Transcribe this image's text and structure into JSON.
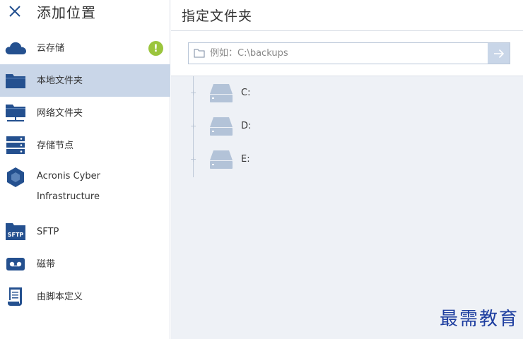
{
  "sidebar": {
    "title": "添加位置",
    "items": [
      {
        "label": "云存储",
        "icon": "cloud-icon",
        "badge": "!"
      },
      {
        "label": "本地文件夹",
        "icon": "folder-icon"
      },
      {
        "label": "网络文件夹",
        "icon": "network-folder-icon"
      },
      {
        "label": "存储节点",
        "icon": "server-icon"
      },
      {
        "label_line1": "Acronis Cyber",
        "label_line2": "Infrastructure",
        "icon": "hexagon-icon"
      },
      {
        "label": "SFTP",
        "icon": "sftp-icon"
      },
      {
        "label": "磁带",
        "icon": "tape-icon"
      },
      {
        "label": "由脚本定义",
        "icon": "script-icon"
      }
    ]
  },
  "main": {
    "title": "指定文件夹",
    "path_placeholder": "例如：C:\\backups",
    "drives": [
      {
        "label": "C:"
      },
      {
        "label": "D:"
      },
      {
        "label": "E:"
      }
    ]
  },
  "watermark": "最需教育",
  "colors": {
    "icon_blue": "#24508f",
    "active_bg": "#c9d6e8",
    "badge_green": "#9bc53d",
    "main_bg": "#eef1f6",
    "drive_gray": "#b3c3d8"
  }
}
